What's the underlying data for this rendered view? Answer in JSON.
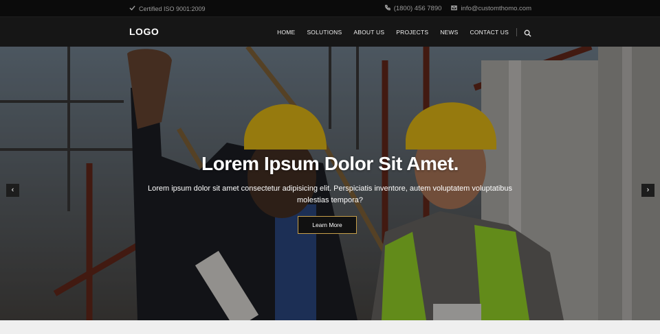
{
  "topbar": {
    "certification": "Certified ISO 9001:2009",
    "phone": "(1800) 456 7890",
    "email": "info@customthomo.com"
  },
  "nav": {
    "logo": "LOGO",
    "items": [
      {
        "label": "HOME"
      },
      {
        "label": "SOLUTIONS"
      },
      {
        "label": "ABOUT US"
      },
      {
        "label": "PROJECTS"
      },
      {
        "label": "NEWS"
      },
      {
        "label": "CONTACT US"
      }
    ]
  },
  "hero": {
    "title": "Lorem Ipsum Dolor Sit Amet.",
    "subtitle": "Lorem ipsum dolor sit amet consectetur adipisicing elit. Perspiciatis inventore, autem voluptatem voluptatibus molestias tempora?",
    "button_label": "Learn More",
    "prev_glyph": "‹",
    "next_glyph": "›"
  },
  "colors": {
    "topbar_bg": "#0b0b0b",
    "navbar_bg": "#161616",
    "button_border": "#c9a14a",
    "helmet": "#f2c618",
    "vest": "#9fe02a"
  },
  "icons": {
    "certification": "check-icon",
    "phone": "phone-icon",
    "email": "mail-icon",
    "search": "search-icon"
  }
}
